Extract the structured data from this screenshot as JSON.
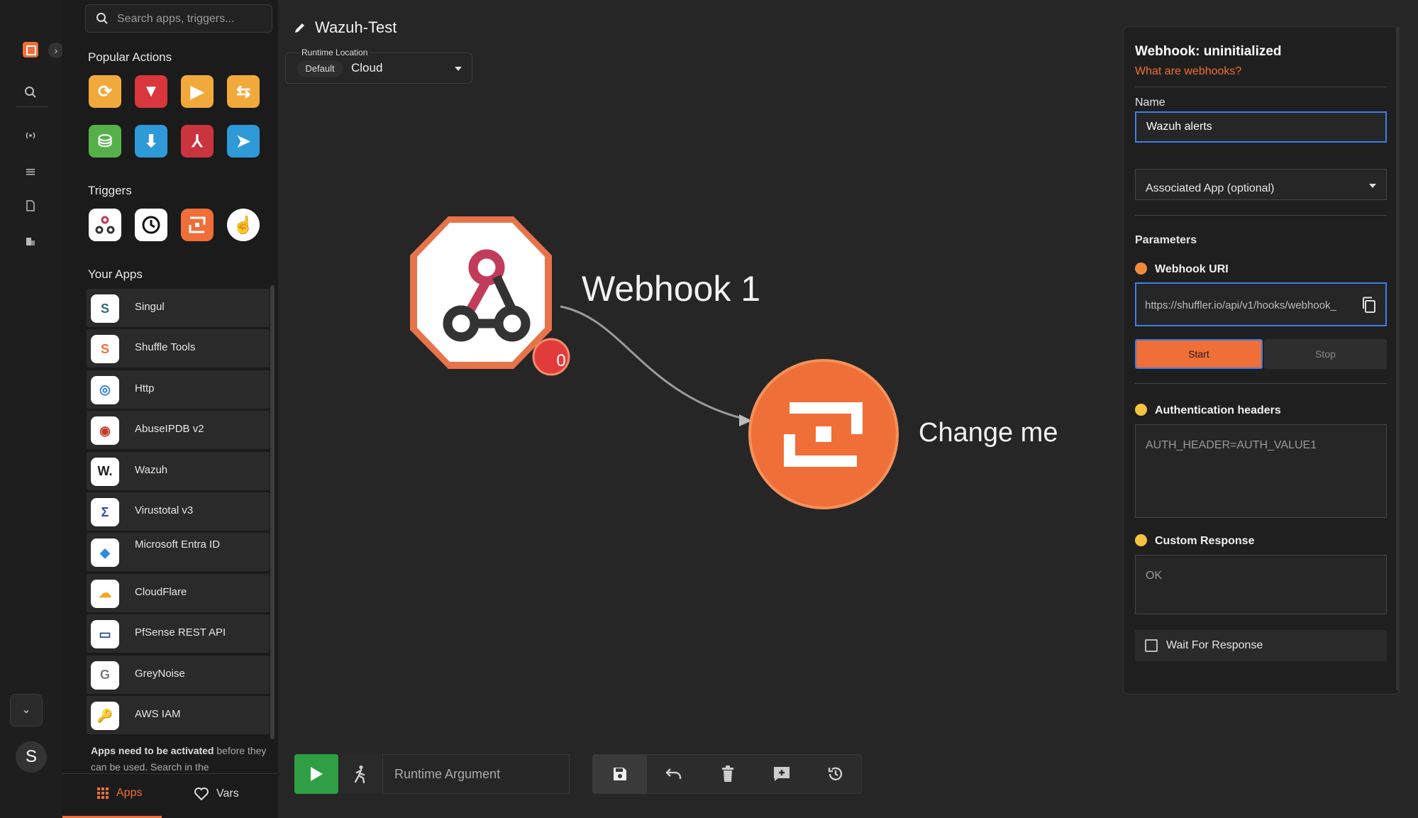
{
  "search": {
    "placeholder": "Search apps, triggers..."
  },
  "sections": {
    "popular": "Popular Actions",
    "triggers": "Triggers",
    "your_apps": "Your Apps"
  },
  "apps": [
    {
      "name": "Singul",
      "icon": "singul-icon",
      "color": "#2d6a7a",
      "glyph": "S"
    },
    {
      "name": "Shuffle Tools",
      "icon": "shuffle-tools-icon",
      "color": "#f06e37",
      "glyph": "S"
    },
    {
      "name": "Http",
      "icon": "http-globe-icon",
      "color": "#2e7fd0",
      "glyph": "◎"
    },
    {
      "name": "AbuseIPDB v2",
      "icon": "abuseipdb-icon",
      "color": "#c0392b",
      "glyph": "◉"
    },
    {
      "name": "Wazuh",
      "icon": "wazuh-icon",
      "color": "#1b1b1b",
      "glyph": "W."
    },
    {
      "name": "Virustotal v3",
      "icon": "virustotal-icon",
      "color": "#2b4fa8",
      "glyph": "Σ"
    },
    {
      "name": "Microsoft Entra ID",
      "icon": "entra-id-icon",
      "color": "#2c8de0",
      "glyph": "◆"
    },
    {
      "name": "CloudFlare",
      "icon": "cloudflare-icon",
      "color": "#f5a623",
      "glyph": "☁"
    },
    {
      "name": "PfSense REST API",
      "icon": "pfsense-icon",
      "color": "#2a4b8d",
      "glyph": "▭"
    },
    {
      "name": "GreyNoise",
      "icon": "greynoise-icon",
      "color": "#7a7a7a",
      "glyph": "G"
    },
    {
      "name": "AWS IAM",
      "icon": "aws-iam-icon",
      "color": "#5b8c2a",
      "glyph": "🔑"
    }
  ],
  "notice": {
    "bold": "Apps need to be activated",
    "rest": " before they can be used. Search in the"
  },
  "bottom_tabs": {
    "apps": "Apps",
    "vars": "Vars"
  },
  "workflow": {
    "title": "Wazuh-Test"
  },
  "runtime": {
    "label": "Runtime Location",
    "chip": "Default",
    "value": "Cloud"
  },
  "nodes": {
    "webhook": {
      "label": "Webhook 1",
      "badge": "0"
    },
    "action": {
      "label": "Change me"
    }
  },
  "toolbar": {
    "runtime_arg_placeholder": "Runtime Argument"
  },
  "panel": {
    "title": "Webhook: uninitialized",
    "help_link": "What are webhooks?",
    "name_label": "Name",
    "name_value": "Wazuh alerts",
    "associated_app": "Associated App (optional)",
    "parameters_label": "Parameters",
    "webhook_uri_label": "Webhook URI",
    "webhook_uri_value": "https://shuffler.io/api/v1/hooks/webhook_",
    "start_label": "Start",
    "stop_label": "Stop",
    "auth_headers_label": "Authentication headers",
    "auth_headers_placeholder": "AUTH_HEADER=AUTH_VALUE1",
    "custom_response_label": "Custom Response",
    "custom_response_placeholder": "OK",
    "wait_label": "Wait For Response"
  },
  "colors": {
    "accent": "#f06e37",
    "focus": "#3d7ee8",
    "run": "#2f9e44",
    "dot_orange": "#f08a3c",
    "dot_yellow": "#f5c242"
  }
}
